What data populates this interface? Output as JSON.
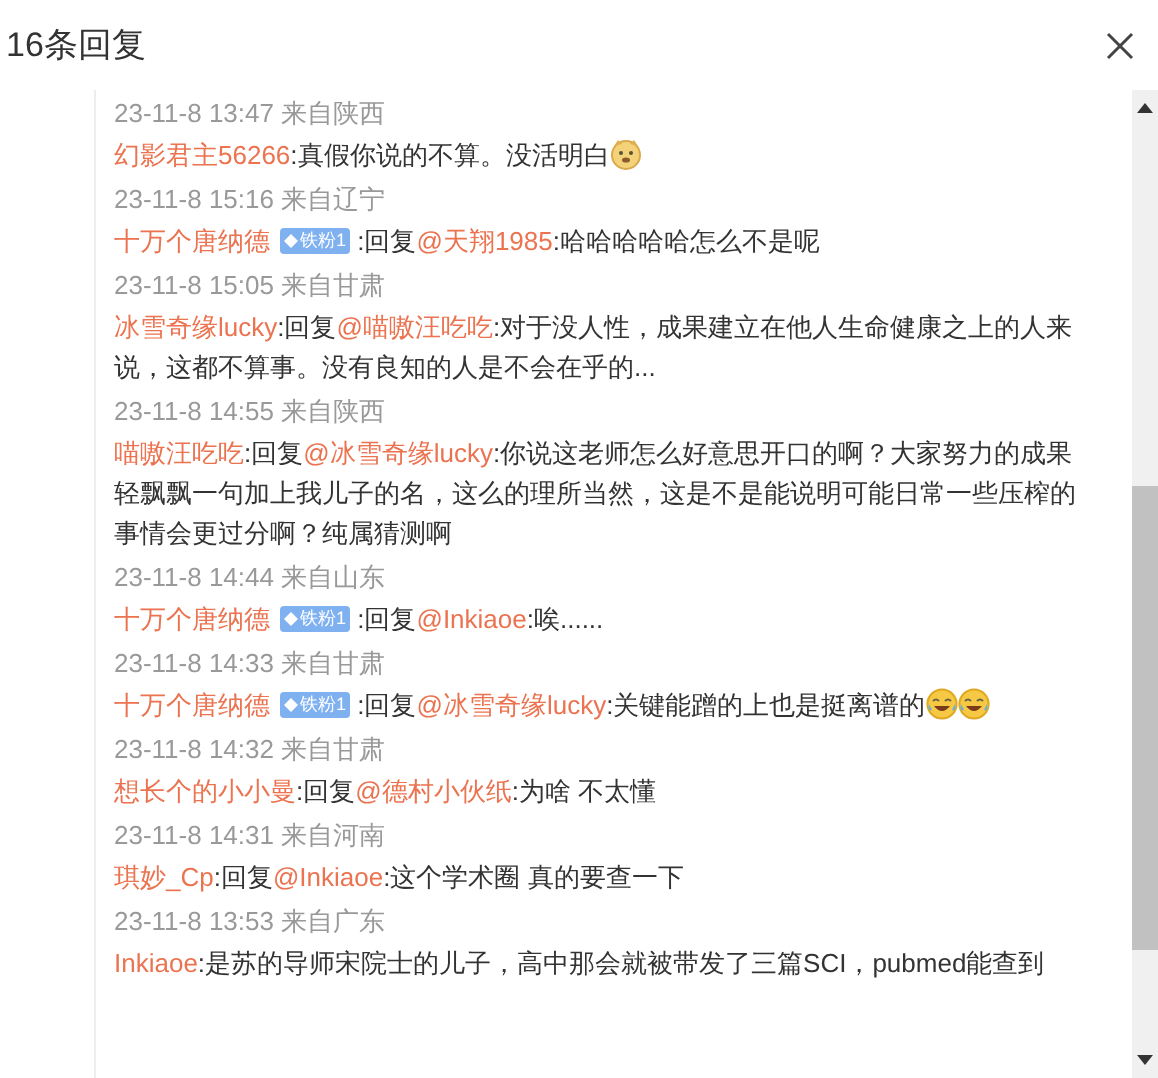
{
  "dialog": {
    "title": "16条回复"
  },
  "replies": [
    {
      "time": "23-11-8 13:47 来自陕西",
      "user": "幻影君主56266",
      "text": ":真假你说的不算。没活明白",
      "emojis": [
        {
          "kind": "dog"
        }
      ]
    },
    {
      "time": "23-11-8 15:16 来自辽宁",
      "user": "十万个唐纳德",
      "badge": "铁粉1",
      "reply_prefix": " :回复",
      "reply_to": "@天翔1985",
      "text": ":哈哈哈哈哈怎么不是呢"
    },
    {
      "time": "23-11-8 15:05 来自甘肃",
      "user": "冰雪奇缘lucky",
      "reply_prefix": ":回复",
      "reply_to": "@喵嗷汪吃吃",
      "text": ":对于没人性，成果建立在他人生命健康之上的人来说，这都不算事。没有良知的人是不会在乎的..."
    },
    {
      "time": "23-11-8 14:55 来自陕西",
      "user": "喵嗷汪吃吃",
      "reply_prefix": ":回复",
      "reply_to": "@冰雪奇缘lucky",
      "text": ":你说这老师怎么好意思开口的啊？大家努力的成果轻飘飘一句加上我儿子的名，这么的理所当然，这是不是能说明可能日常一些压榨的事情会更过分啊？纯属猜测啊"
    },
    {
      "time": "23-11-8 14:44 来自山东",
      "user": "十万个唐纳德",
      "badge": "铁粉1",
      "reply_prefix": " :回复",
      "reply_to": "@Inkiaoe",
      "text": ":唉......"
    },
    {
      "time": "23-11-8 14:33 来自甘肃",
      "user": "十万个唐纳德",
      "badge": "铁粉1",
      "reply_prefix": " :回复",
      "reply_to": "@冰雪奇缘lucky",
      "text": ":关键能蹭的上也是挺离谱的",
      "emojis": [
        {
          "kind": "laugh"
        },
        {
          "kind": "laugh"
        }
      ]
    },
    {
      "time": "23-11-8 14:32 来自甘肃",
      "user": "想长个的小小曼",
      "reply_prefix": ":回复",
      "reply_to": "@德村小伙纸",
      "text": ":为啥 不太懂"
    },
    {
      "time": "23-11-8 14:31 来自河南",
      "user": "琪妙_Cp",
      "reply_prefix": ":回复",
      "reply_to": "@Inkiaoe",
      "text": ":这个学术圈 真的要查一下"
    },
    {
      "time": "23-11-8 13:53 来自广东",
      "user": "Inkiaoe",
      "text": ":是苏的导师宋院士的儿子，高中那会就被带发了三篇SCI，pubmed能查到"
    }
  ]
}
